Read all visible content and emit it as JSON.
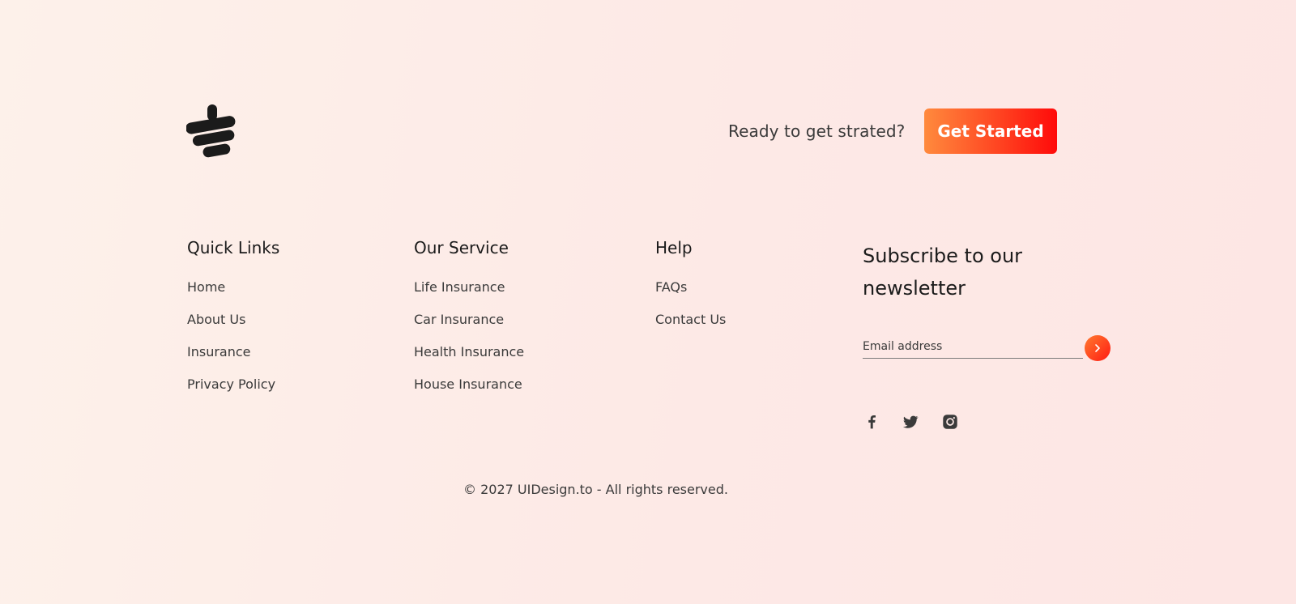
{
  "brand": {
    "logo_icon": "stacked-bars-logo-icon"
  },
  "cta": {
    "prompt": "Ready to get strated?",
    "button_label": "Get Started",
    "gradient_start": "#ff8a3d",
    "gradient_end": "#ff0a0a"
  },
  "columns": {
    "quick_links": {
      "heading": "Quick Links",
      "items": [
        "Home",
        "About Us",
        "Insurance",
        "Privacy Policy"
      ]
    },
    "our_service": {
      "heading": "Our Service",
      "items": [
        "Life Insurance",
        "Car Insurance",
        "Health Insurance",
        "House Insurance"
      ]
    },
    "help": {
      "heading": "Help",
      "items": [
        "FAQs",
        "Contact Us"
      ]
    }
  },
  "newsletter": {
    "heading": "Subscribe to our newsletter",
    "email_placeholder": "Email address",
    "email_value": "",
    "submit_icon": "chevron-right-icon"
  },
  "social": [
    "facebook-icon",
    "twitter-icon",
    "instagram-icon"
  ],
  "footer": {
    "copyright": "© 2027 UIDesign.to - All rights reserved."
  },
  "colors": {
    "text_dark": "#1b1b1b",
    "text_body": "#3a3a3a",
    "accent": "#ff3f1f"
  }
}
